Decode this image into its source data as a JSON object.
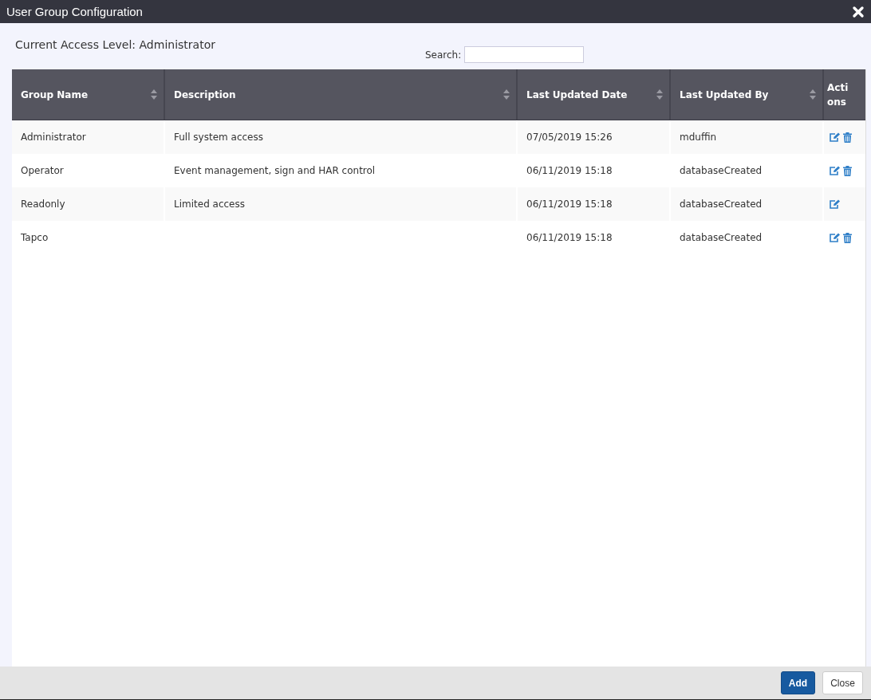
{
  "window": {
    "title": "User Group Configuration"
  },
  "access_level": "Current Access Level: Administrator",
  "search": {
    "label": "Search:"
  },
  "table": {
    "columns": [
      {
        "label": "Group Name",
        "sortable": true
      },
      {
        "label": "Description",
        "sortable": true
      },
      {
        "label": "Last Updated Date",
        "sortable": true
      },
      {
        "label": "Last Updated By",
        "sortable": true
      },
      {
        "label": "Actions",
        "sortable": false
      }
    ],
    "rows": [
      {
        "group_name": "Administrator",
        "description": "Full system access",
        "last_updated_date": "07/05/2019 15:26",
        "last_updated_by": "mduffin",
        "deletable": true
      },
      {
        "group_name": "Operator",
        "description": "Event management, sign and HAR control",
        "last_updated_date": "06/11/2019 15:18",
        "last_updated_by": "databaseCreated",
        "deletable": true
      },
      {
        "group_name": "Readonly",
        "description": "Limited access",
        "last_updated_date": "06/11/2019 15:18",
        "last_updated_by": "databaseCreated",
        "deletable": false
      },
      {
        "group_name": "Tapco",
        "last_updated_date": "06/11/2019 15:18",
        "last_updated_by": "databaseCreated",
        "deletable": true
      }
    ]
  },
  "buttons": [
    {
      "label": "Add",
      "kind": "primary"
    },
    {
      "label": "Close",
      "kind": "secondary"
    }
  ]
}
